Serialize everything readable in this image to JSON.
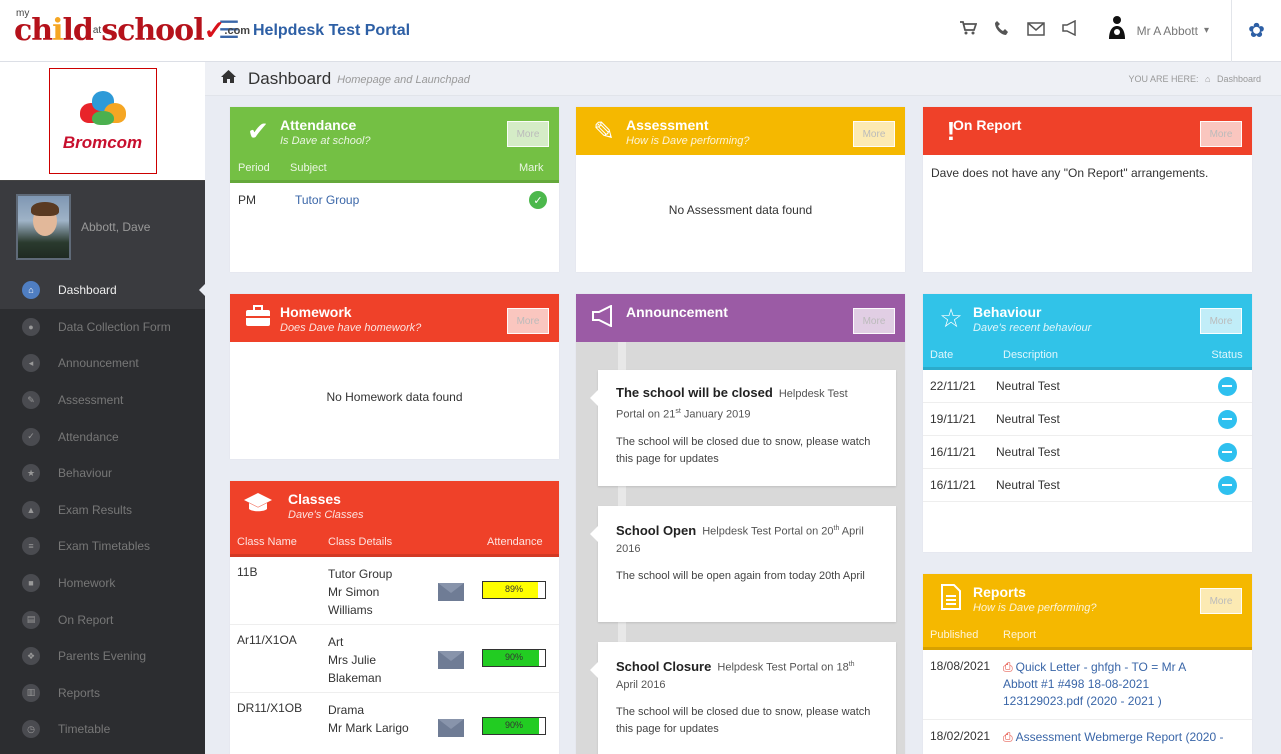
{
  "logo": {
    "my": "my",
    "a": "ch",
    "i": "i",
    "b": "ld",
    "at": "at",
    "c": "school",
    "com": ".com"
  },
  "header": {
    "menu_icon": "hamburger-icon",
    "portal_title": "Helpdesk Test Portal",
    "user_name": "Mr A Abbott"
  },
  "sidebar": {
    "school_name": "Bromcom",
    "student_name": "Abbott, Dave",
    "items": [
      {
        "label": "Dashboard",
        "icon": "home-icon",
        "active": true
      },
      {
        "label": "Data Collection Form",
        "icon": "person-icon"
      },
      {
        "label": "Announcement",
        "icon": "megaphone-icon"
      },
      {
        "label": "Assessment",
        "icon": "pencil-icon"
      },
      {
        "label": "Attendance",
        "icon": "check-icon"
      },
      {
        "label": "Behaviour",
        "icon": "star-icon"
      },
      {
        "label": "Exam Results",
        "icon": "graduation-icon"
      },
      {
        "label": "Exam Timetables",
        "icon": "list-icon"
      },
      {
        "label": "Homework",
        "icon": "briefcase-icon"
      },
      {
        "label": "On Report",
        "icon": "document-icon"
      },
      {
        "label": "Parents Evening",
        "icon": "group-icon"
      },
      {
        "label": "Reports",
        "icon": "report-icon"
      },
      {
        "label": "Timetable",
        "icon": "clock-icon"
      }
    ]
  },
  "pagebar": {
    "title": "Dashboard",
    "subtitle": "Homepage and Launchpad",
    "you_are_here": "YOU ARE HERE:",
    "crumb": "Dashboard"
  },
  "common": {
    "more_label": "More"
  },
  "attendance": {
    "title": "Attendance",
    "subtitle": "Is Dave at school?",
    "columns": [
      "Period",
      "Subject",
      "Mark"
    ],
    "rows": [
      {
        "period": "PM",
        "subject": "Tutor Group"
      }
    ]
  },
  "assessment": {
    "title": "Assessment",
    "subtitle": "How is Dave performing?",
    "empty": "No Assessment data found"
  },
  "onreport": {
    "title": "On Report",
    "message": "Dave does not have any \"On Report\" arrangements."
  },
  "homework": {
    "title": "Homework",
    "subtitle": "Does Dave have homework?",
    "empty": "No Homework data found"
  },
  "announcement": {
    "title": "Announcement",
    "items": [
      {
        "title": "The school will be closed",
        "source": "Helpdesk Test Portal on 21",
        "suffix": "st",
        "date": " January 2019",
        "body": "The school will be closed due to snow, please watch this page for updates"
      },
      {
        "title": "School Open",
        "source": "Helpdesk Test Portal on 20",
        "suffix": "th",
        "date": " April 2016",
        "body": "The school will be open again from today 20th April"
      },
      {
        "title": "School Closure",
        "source": "Helpdesk Test Portal on 18",
        "suffix": "th",
        "date": " April 2016",
        "body": "The school will be closed due to snow, please watch this page for updates"
      }
    ]
  },
  "behaviour": {
    "title": "Behaviour",
    "subtitle": "Dave's recent behaviour",
    "columns": [
      "Date",
      "Description",
      "Status"
    ],
    "rows": [
      {
        "date": "22/11/21",
        "description": "Neutral Test"
      },
      {
        "date": "19/11/21",
        "description": "Neutral Test"
      },
      {
        "date": "16/11/21",
        "description": "Neutral Test"
      },
      {
        "date": "16/11/21",
        "description": "Neutral Test"
      }
    ]
  },
  "classes": {
    "title": "Classes",
    "subtitle": "Dave's Classes",
    "columns": [
      "Class Name",
      "Class Details",
      "Attendance"
    ],
    "rows": [
      {
        "name": "11B",
        "subject": "Tutor Group",
        "teacher": "Mr Simon",
        "teacher2": "Williams",
        "attendance": "89%",
        "fraction": 0.89,
        "color": "#ffff00"
      },
      {
        "name": "Ar11/X1OA",
        "subject": "Art",
        "teacher": "Mrs Julie",
        "teacher2": "Blakeman",
        "attendance": "90%",
        "fraction": 0.9,
        "color": "#22cc22"
      },
      {
        "name": "DR11/X1OB",
        "subject": "Drama",
        "teacher": "Mr Mark Larigo",
        "teacher2": "",
        "attendance": "90%",
        "fraction": 0.9,
        "color": "#22cc22"
      }
    ]
  },
  "reports": {
    "title": "Reports",
    "subtitle": "How is Dave performing?",
    "columns": [
      "Published",
      "Report"
    ],
    "rows": [
      {
        "date": "18/08/2021",
        "l1": "Quick Letter - ghfgh - TO = Mr A",
        "l2": "Abbott #1 #498 18-08-2021",
        "l3": "123129023.pdf (2020 - 2021 )"
      },
      {
        "date": "18/02/2021",
        "l1": "Assessment Webmerge Report (2020 -",
        "l2": "",
        "l3": ""
      }
    ]
  },
  "colors": {
    "green": "#74c044",
    "yellow": "#f5b800",
    "red": "#ef4129",
    "purple": "#9b5ba5",
    "cyan": "#31c3e8",
    "brand_blue": "#2d5fa5"
  }
}
